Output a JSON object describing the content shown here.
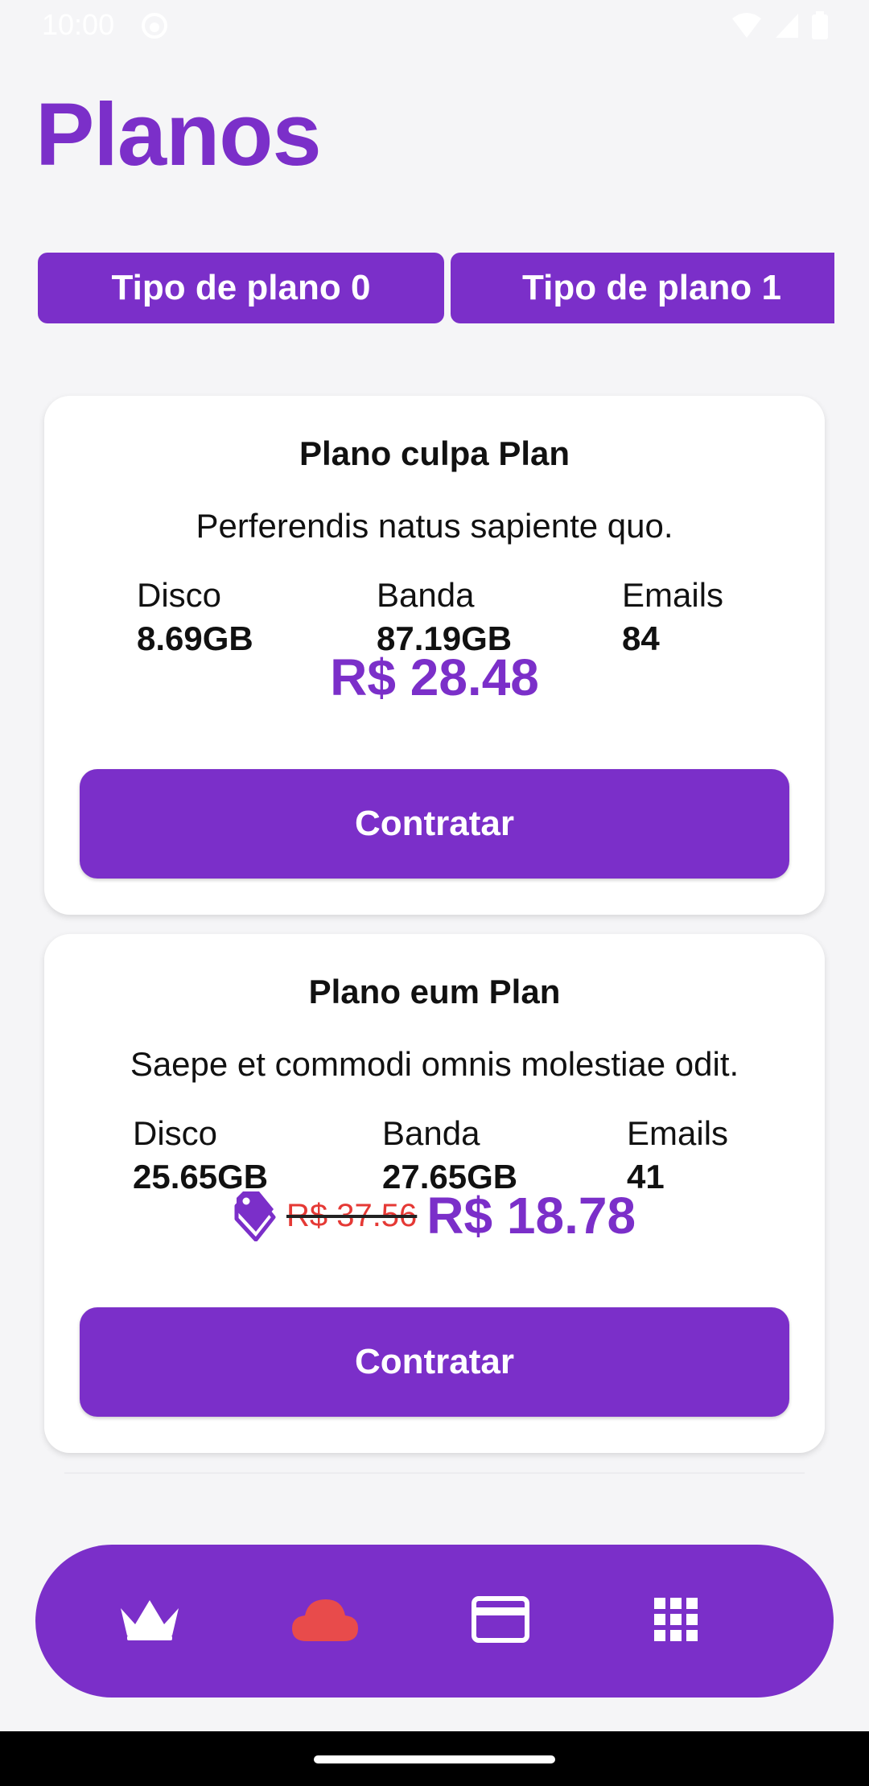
{
  "status_bar": {
    "time": "10:00"
  },
  "page": {
    "title": "Planos"
  },
  "tabs": [
    {
      "label": "Tipo de plano 0"
    },
    {
      "label": "Tipo de plano 1"
    }
  ],
  "plans": [
    {
      "title": "Plano culpa Plan",
      "description": "Perferendis natus sapiente quo.",
      "specs": [
        {
          "label": "Disco",
          "value": "8.69GB"
        },
        {
          "label": "Banda",
          "value": "87.19GB"
        },
        {
          "label": "Emails",
          "value": "84"
        }
      ],
      "price": "R$ 28.48",
      "button_label": "Contratar"
    },
    {
      "title": "Plano eum Plan",
      "description": "Saepe et commodi omnis molestiae odit.",
      "specs": [
        {
          "label": "Disco",
          "value": "25.65GB"
        },
        {
          "label": "Banda",
          "value": "27.65GB"
        },
        {
          "label": "Emails",
          "value": "41"
        }
      ],
      "old_price": "R$ 37.56",
      "price": "R$ 18.78",
      "button_label": "Contratar"
    }
  ],
  "bottom_nav": {
    "items": [
      {
        "icon": "crown-icon",
        "active": false
      },
      {
        "icon": "cloud-icon",
        "active": true
      },
      {
        "icon": "credit-card-icon",
        "active": false
      },
      {
        "icon": "apps-grid-icon",
        "active": false
      }
    ]
  },
  "colors": {
    "primary": "#7b2fc9",
    "active_nav": "#e84b4b",
    "discount_old_price": "#e53935",
    "background": "#f5f5f7"
  }
}
